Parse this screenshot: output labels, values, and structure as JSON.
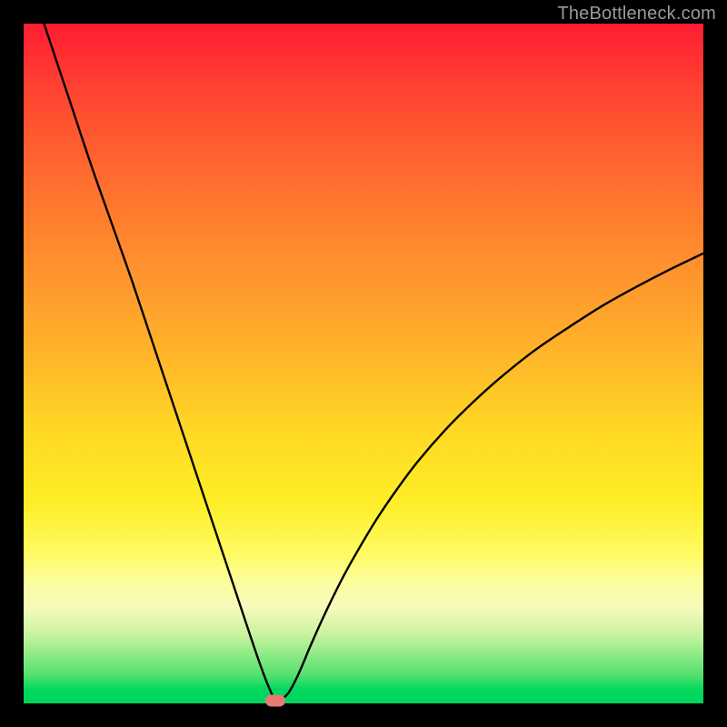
{
  "watermark": "TheBottleneck.com",
  "colors": {
    "page_bg": "#000000",
    "curve_stroke": "#000000",
    "marker_fill": "#e77b74",
    "watermark_text": "#9a9a9a",
    "gradient_top": "#ff1d33",
    "gradient_bottom": "#00d45e"
  },
  "chart_data": {
    "type": "line",
    "title": "",
    "xlabel": "",
    "ylabel": "",
    "xlim": [
      0,
      100
    ],
    "ylim": [
      0,
      100
    ],
    "grid": false,
    "legend_position": "none",
    "series": [
      {
        "name": "curve",
        "x": [
          3,
          5,
          7,
          10,
          13,
          16,
          19,
          22,
          25,
          28,
          30,
          32,
          34,
          35.5,
          36.5,
          37,
          37.5,
          38,
          39,
          40,
          41,
          42,
          43.5,
          45,
          47,
          49,
          52,
          55,
          58,
          62,
          66,
          70,
          75,
          80,
          85,
          90,
          95,
          100
        ],
        "y": [
          100,
          94,
          88,
          79,
          70.5,
          62,
          53,
          44,
          35,
          26,
          20,
          14,
          8,
          3.8,
          1.4,
          0.6,
          0.4,
          0.6,
          1.6,
          3.4,
          5.6,
          8.0,
          11.4,
          14.6,
          18.6,
          22.2,
          27.2,
          31.6,
          35.6,
          40.2,
          44.2,
          47.8,
          51.8,
          55.2,
          58.4,
          61.2,
          63.8,
          66.2
        ]
      }
    ],
    "marker": {
      "x": 37,
      "y": 0.4
    },
    "background_gradient_stops": [
      {
        "pct": 0,
        "color": "#ff1d33"
      },
      {
        "pct": 10,
        "color": "#ff4431"
      },
      {
        "pct": 22,
        "color": "#ff6a2f"
      },
      {
        "pct": 35,
        "color": "#ff8f2e"
      },
      {
        "pct": 48,
        "color": "#ffb32a"
      },
      {
        "pct": 60,
        "color": "#ffd825"
      },
      {
        "pct": 70,
        "color": "#feed25"
      },
      {
        "pct": 78,
        "color": "#fffb62"
      },
      {
        "pct": 82,
        "color": "#fdfd9e"
      },
      {
        "pct": 86,
        "color": "#f5fbbc"
      },
      {
        "pct": 90,
        "color": "#c6f39f"
      },
      {
        "pct": 93,
        "color": "#8cea85"
      },
      {
        "pct": 96,
        "color": "#4fe06d"
      },
      {
        "pct": 98,
        "color": "#00d85e"
      },
      {
        "pct": 100,
        "color": "#00d45e"
      }
    ]
  }
}
